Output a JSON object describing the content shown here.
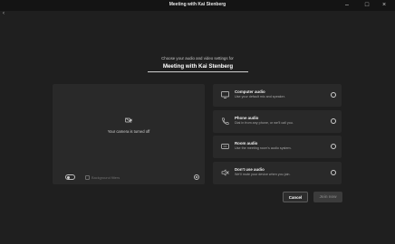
{
  "window": {
    "title": "Meeting with Kai Stenberg"
  },
  "header": {
    "subtitle": "Choose your audio and video settings for",
    "meeting_name": "Meeting with Kai Stenberg"
  },
  "video": {
    "camera_off_text": "Your camera is turned off",
    "toggle_label": "🖼",
    "background_filters_label": "Background filters"
  },
  "audio_options": [
    {
      "title": "Computer audio",
      "description": "Use your default mic and speaker.",
      "icon": "computer-audio-icon"
    },
    {
      "title": "Phone audio",
      "description": "Dial in from any phone, or we'll call you.",
      "icon": "phone-audio-icon"
    },
    {
      "title": "Room audio",
      "description": "Use the meeting room's audio system.",
      "icon": "room-audio-icon"
    },
    {
      "title": "Don't use audio",
      "description": "We'll mute your device when you join.",
      "icon": "no-audio-icon"
    }
  ],
  "actions": {
    "cancel_label": "Cancel",
    "join_label": "Join now"
  },
  "colors": {
    "background": "#1f1f1f",
    "panel": "#292929",
    "titlebar": "#141414"
  }
}
